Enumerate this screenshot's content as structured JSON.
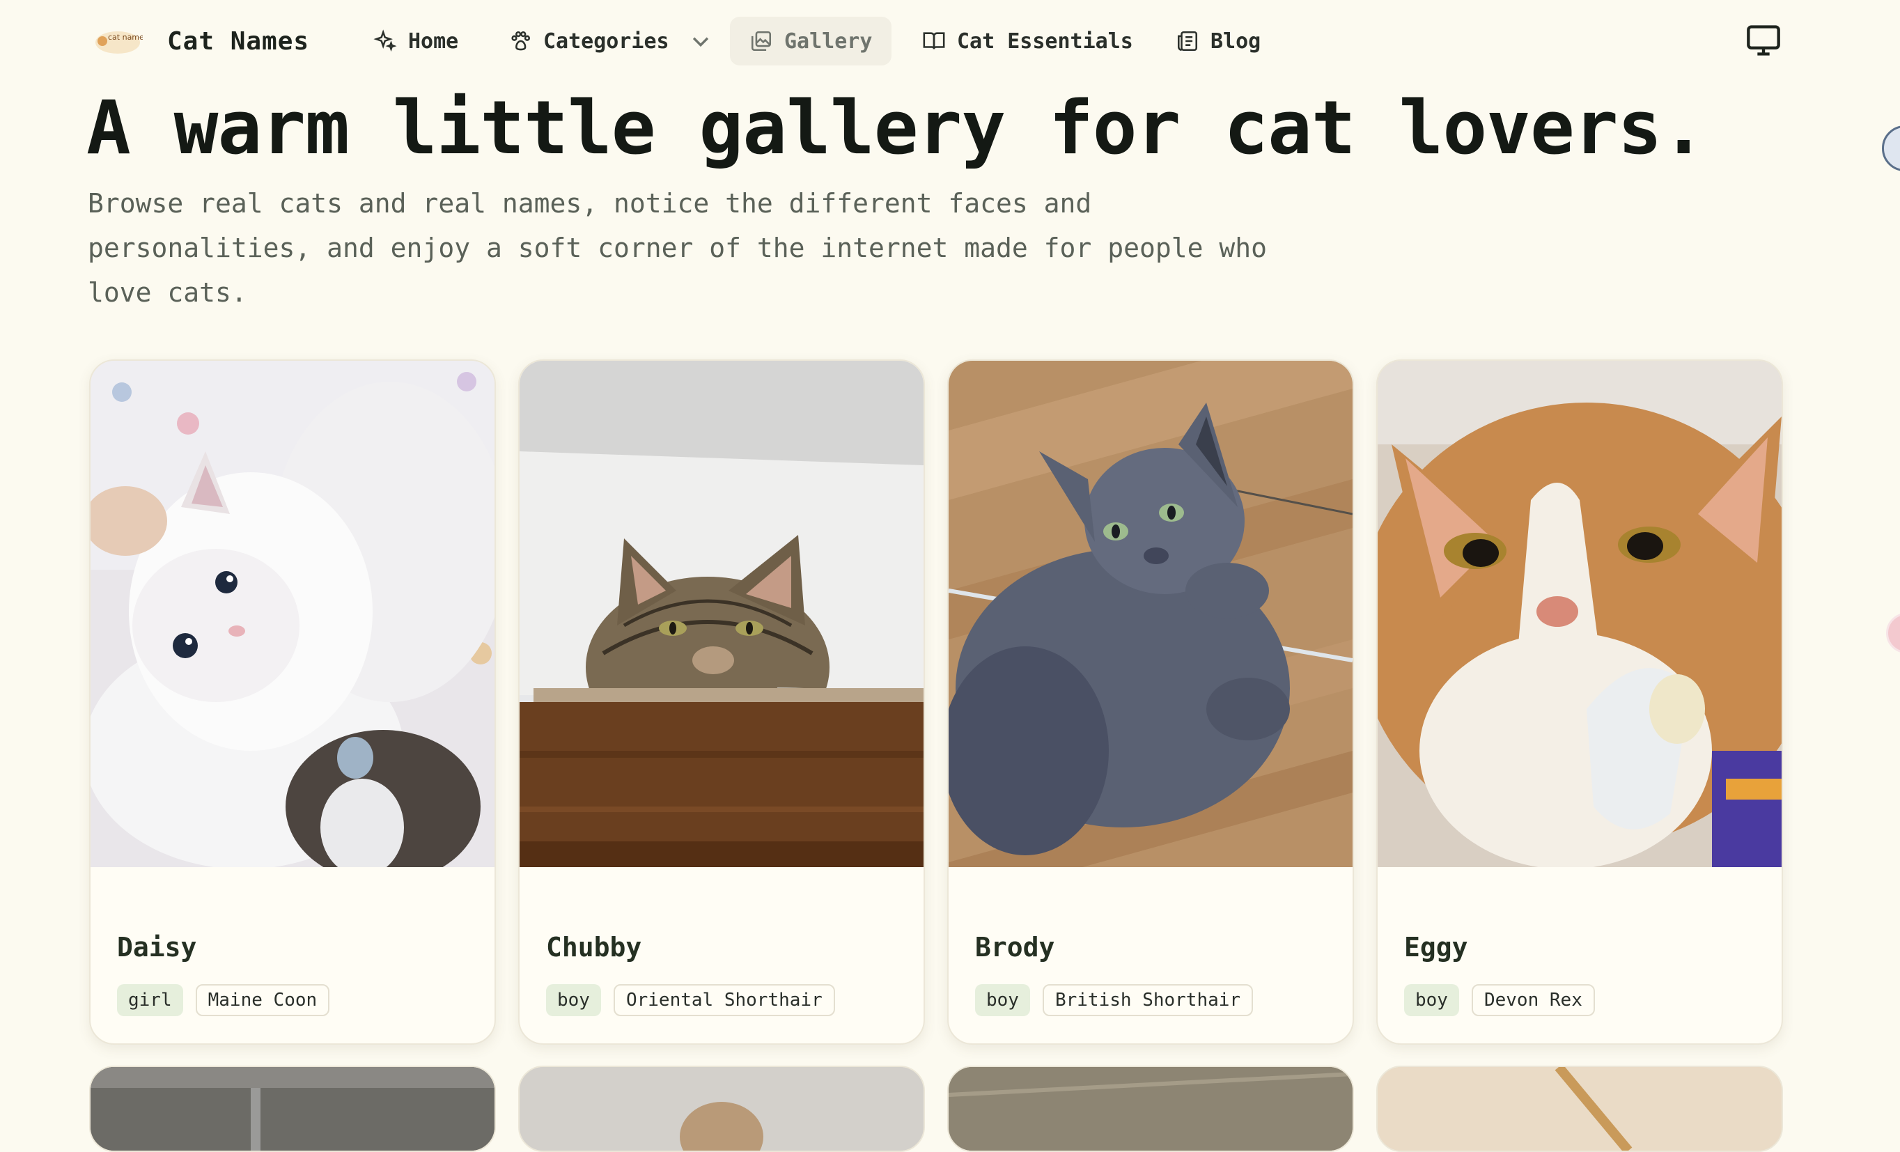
{
  "brand": {
    "name": "Cat Names",
    "logo_text": "cat names"
  },
  "nav": {
    "home": "Home",
    "categories": "Categories",
    "gallery": "Gallery",
    "essentials": "Cat Essentials",
    "blog": "Blog"
  },
  "hero": {
    "title": "A warm little gallery for cat lovers.",
    "subtitle": "Browse real cats and real names, notice the different faces and personalities, and enjoy a soft corner of the internet made for people who love cats."
  },
  "cards": [
    {
      "name": "Daisy",
      "gender": "girl",
      "breed": "Maine Coon"
    },
    {
      "name": "Chubby",
      "gender": "boy",
      "breed": "Oriental Shorthair"
    },
    {
      "name": "Brody",
      "gender": "boy",
      "breed": "British Shorthair"
    },
    {
      "name": "Eggy",
      "gender": "boy",
      "breed": "Devon Rex"
    }
  ],
  "colors": {
    "background": "#fcfaf0",
    "gender_tag": "#e6efdc",
    "text": "#1d231d"
  }
}
